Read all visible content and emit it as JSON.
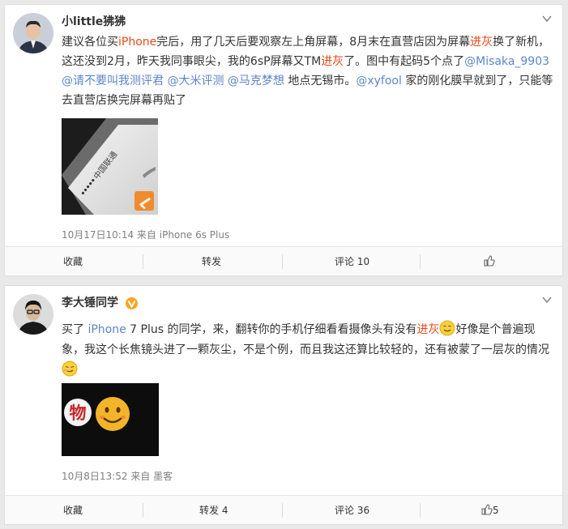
{
  "posts": [
    {
      "username": "小little狒狒",
      "text": {
        "l1_a": "建议各位买",
        "l1_b": "iPhone",
        "l1_c": "完后，用了几天后要观察左上角屏幕，8月末在直营店因为屏幕",
        "l1_d": "进灰",
        "l1_e": "换了新机，",
        "l2_a": "这还没到2月，昨天我同事眼尖，我的6sP屏幕又TM",
        "l2_b": "进灰",
        "l2_c": "了。图中有起码5个点了",
        "l2_d": "@Misaka_9903",
        "l3_a": "@请不要叫我测评君",
        "l3_b": " ",
        "l3_c": "@大米评测",
        "l3_d": " ",
        "l3_e": "@马克梦想",
        "l3_f": " 地点无锡市。",
        "l3_g": "@xyfool",
        "l3_h": " 家的刚化膜早就到了，只能等",
        "l4": "去直营店换完屏幕再贴了"
      },
      "photo_text": "中国联通",
      "meta": "10月17日10:14 来自 iPhone 6s Plus",
      "actions": {
        "favorite": "收藏",
        "repost": "转发",
        "comment": "评论 10",
        "like": ""
      }
    },
    {
      "username": "李大锤同学",
      "text": {
        "l1_a": "买了 ",
        "l1_b": "iPhone",
        "l1_c": " 7 Plus 的同学，来，翻转你的手机仔细看看摄像头有没有",
        "l1_d": "进灰",
        "l1_e": "好像是个普遍现",
        "l2": "象，我这个长焦镜头进了一颗灰尘，不是个例，而且我这还算比较轻的，还有被蒙了一层灰的情况"
      },
      "photo_text": "物",
      "meta": "10月8日13:52 来自 墨客",
      "actions": {
        "favorite": "收藏",
        "repost": "转发 4",
        "comment": "评论 36",
        "like": "5"
      }
    }
  ],
  "colors": {
    "link": "#5b87c9",
    "keyword": "#e64a19",
    "badge": "#f5a623"
  }
}
